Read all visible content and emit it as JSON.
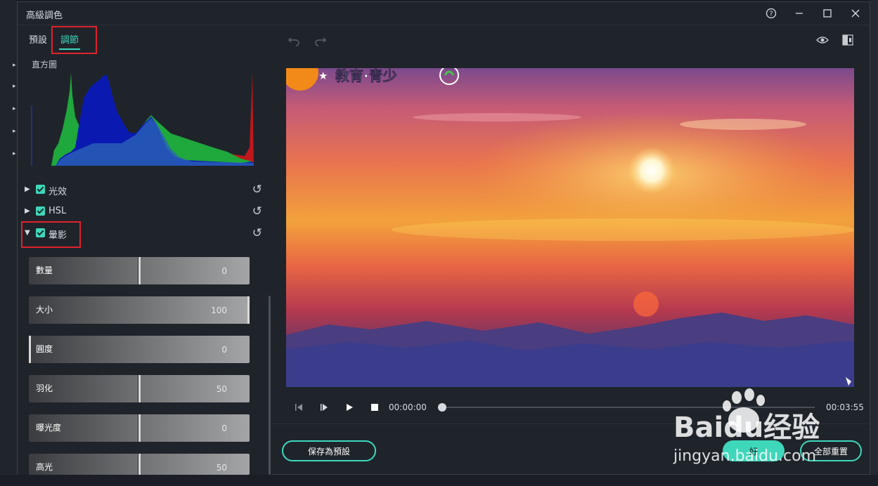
{
  "window": {
    "title": "高級調色",
    "controls": [
      "help-icon",
      "minimize-icon",
      "maximize-icon",
      "close-icon"
    ]
  },
  "tabs": [
    {
      "label": "預設",
      "active": false
    },
    {
      "label": "調節",
      "active": true
    }
  ],
  "histogram": {
    "label": "直方圖"
  },
  "sections": [
    {
      "label": "光效",
      "expanded": false,
      "checked": true
    },
    {
      "label": "HSL",
      "expanded": false,
      "checked": true
    },
    {
      "label": "暈影",
      "expanded": true,
      "checked": true
    }
  ],
  "sliders": [
    {
      "label": "數量",
      "value": "0"
    },
    {
      "label": "大小",
      "value": "100"
    },
    {
      "label": "圓度",
      "value": "0"
    },
    {
      "label": "羽化",
      "value": "50"
    },
    {
      "label": "曝光度",
      "value": "0"
    },
    {
      "label": "高光",
      "value": "50"
    }
  ],
  "preview": {
    "overlay_text": "教育·青少"
  },
  "player": {
    "current_time": "00:00:00",
    "total_time": "00:03:55",
    "progress": 0
  },
  "footer": {
    "save_preset": "保存為預設",
    "ok": "好",
    "reset_all": "全部重置"
  },
  "watermark": {
    "brand": "Baidu经验",
    "url": "jingyan.baidu.com"
  },
  "colors": {
    "accent": "#3fd7bb",
    "highlight_box": "#e0222b",
    "panel_bg": "#1f242b"
  }
}
